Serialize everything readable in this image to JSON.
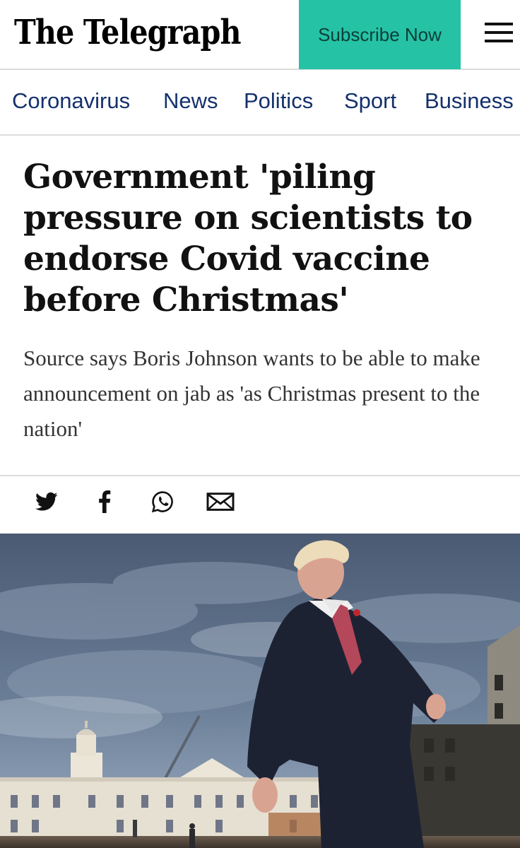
{
  "header": {
    "logo_text": "The Telegraph",
    "subscribe_label": "Subscribe Now",
    "menu_icon": "hamburger-menu-icon"
  },
  "nav": {
    "items": [
      "Coronavirus",
      "News",
      "Politics",
      "Sport",
      "Business"
    ]
  },
  "article": {
    "headline": "Government 'piling pressure on scientists to endorse Covid vaccine before Christmas'",
    "standfirst": "Source says Boris Johnson wants to be able to make announcement on jab as 'as Christmas present to the nation'"
  },
  "share": {
    "icons": [
      "twitter-icon",
      "facebook-icon",
      "whatsapp-icon",
      "email-icon"
    ]
  },
  "colors": {
    "accent": "#25c2a6",
    "nav_text": "#14316b",
    "sky": "#52657d",
    "suit": "#1d2233",
    "tie": "#b5475a",
    "building": "#e9e4d8"
  }
}
